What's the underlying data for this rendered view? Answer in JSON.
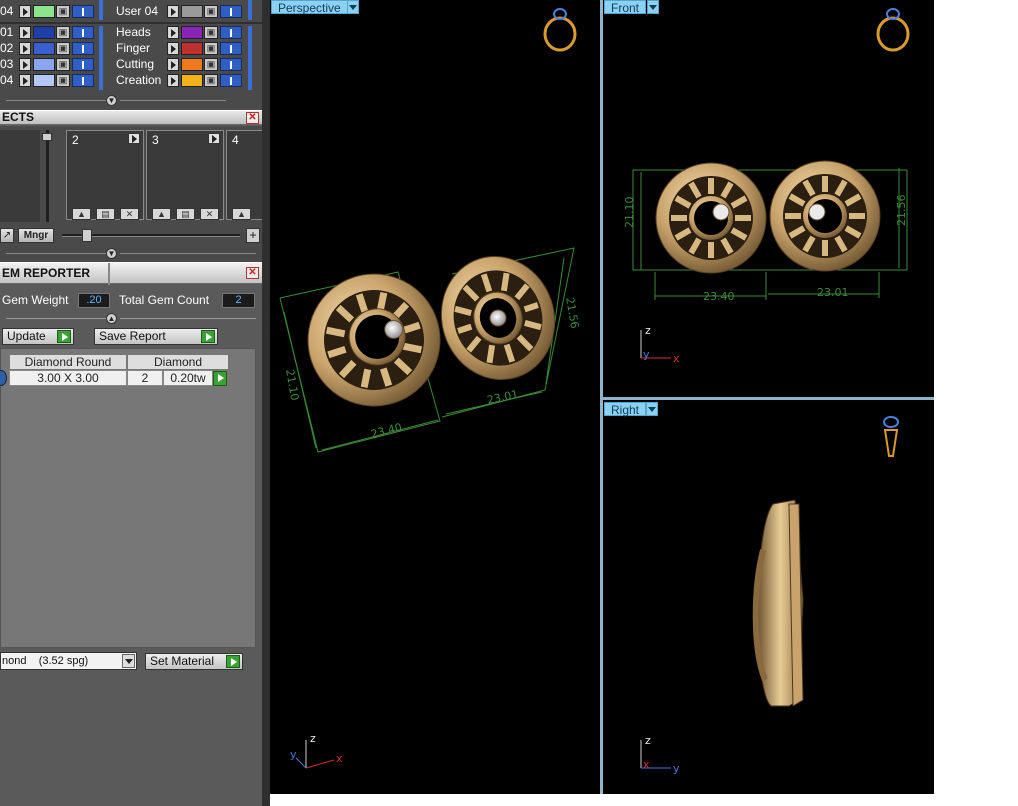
{
  "layers": {
    "rows": [
      {
        "num": "04",
        "swatch": "#8be58b",
        "name": "User 04",
        "swatch2": "#9a9a9a"
      },
      {
        "num": "01",
        "swatch": "#1f3ea8",
        "name": "Heads",
        "swatch2": "#8a24b8"
      },
      {
        "num": "02",
        "swatch": "#3a5fd0",
        "name": "Finger",
        "swatch2": "#c03030"
      },
      {
        "num": "03",
        "swatch": "#8aa6f0",
        "name": "Cutting",
        "swatch2": "#f07a1a"
      },
      {
        "num": "04",
        "swatch": "#b3c8f7",
        "name": "Creation",
        "swatch2": "#f3b21a"
      }
    ]
  },
  "objects": {
    "title": "ECTS",
    "slots": [
      "2",
      "3",
      "4"
    ],
    "mngr_label": "Mngr",
    "plus_label": "+"
  },
  "gem_reporter": {
    "title": "EM REPORTER",
    "gem_weight_label": "Gem Weight",
    "gem_weight_value": ".20",
    "total_gem_count_label": "Total Gem Count",
    "total_gem_count_value": "2",
    "update_label": "Update",
    "save_report_label": "Save Report",
    "table": {
      "headers": [
        "Diamond Round",
        "Diamond"
      ],
      "row": {
        "size": "3.00 X 3.00",
        "count": "2",
        "weight": "0.20tw"
      }
    },
    "material_value": "nond    (3.52 spg)",
    "set_material_label": "Set Material"
  },
  "viewports": {
    "perspective": {
      "label": "Perspective",
      "dims": [
        "21.10",
        "23.40",
        "23.01",
        "21.56"
      ]
    },
    "front": {
      "label": "Front",
      "dims": [
        "21.10",
        "23.40",
        "23.01",
        "21.56"
      ]
    },
    "right": {
      "label": "Right"
    },
    "axes": {
      "x": "x",
      "y": "y",
      "z": "z"
    }
  },
  "colors": {
    "viewport_bg": "#000000",
    "gold": "#c9a36b",
    "guide_green": "#3b8a3b",
    "tab_blue": "#8bd2f2"
  }
}
